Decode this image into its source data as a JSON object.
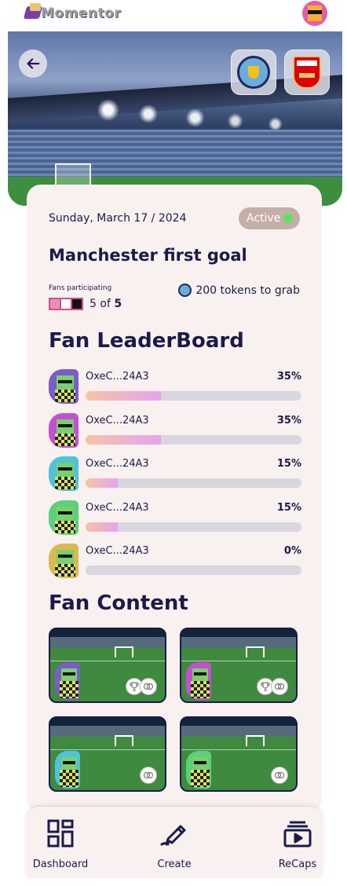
{
  "app": {
    "name": "Momentor"
  },
  "match": {
    "home_club": "Manchester City",
    "away_club": "Arsenal"
  },
  "event": {
    "date": "Sunday, March 17 / 2024",
    "status": "Active",
    "title": "Manchester first goal",
    "fans_label": "Fans participating",
    "fans_current": "5",
    "fans_of": "of",
    "fans_total": "5",
    "tokens_text": "200 tokens to grab"
  },
  "leaderboard": {
    "title": "Fan LeaderBoard",
    "rows": [
      {
        "address": "OxeC...24A3",
        "percent_label": "35%",
        "percent": 35,
        "avatar_color": "#7b5cc9"
      },
      {
        "address": "OxeC...24A3",
        "percent_label": "35%",
        "percent": 35,
        "avatar_color": "#c44fd1"
      },
      {
        "address": "OxeC...24A3",
        "percent_label": "15%",
        "percent": 15,
        "avatar_color": "#4fc3d9"
      },
      {
        "address": "OxeC...24A3",
        "percent_label": "15%",
        "percent": 15,
        "avatar_color": "#5ad17a"
      },
      {
        "address": "OxeC...24A3",
        "percent_label": "0%",
        "percent": 0,
        "avatar_color": "#d9b94f"
      }
    ]
  },
  "fan_content": {
    "title": "Fan Content",
    "videos": [
      {
        "avatar_color": "#7b5cc9",
        "reactions": [
          "trophy-icon",
          "rings-icon"
        ]
      },
      {
        "avatar_color": "#c44fd1",
        "reactions": [
          "trophy-icon",
          "rings-icon"
        ]
      },
      {
        "avatar_color": "#4fc3d9",
        "reactions": [
          "rings-icon"
        ]
      },
      {
        "avatar_color": "#5ad17a",
        "reactions": [
          "rings-icon"
        ]
      }
    ]
  },
  "nav": {
    "items": [
      {
        "label": "Dashboard",
        "icon": "dashboard-icon"
      },
      {
        "label": "Create",
        "icon": "pen-icon"
      },
      {
        "label": "ReCaps",
        "icon": "recaps-icon"
      }
    ]
  },
  "colors": {
    "primary_text": "#1c1a4a",
    "card_bg": "#f8f1ef",
    "active_dot": "#5fe35f",
    "status_pill": "#c4afa8",
    "progress_track": "#d9d6e0"
  }
}
